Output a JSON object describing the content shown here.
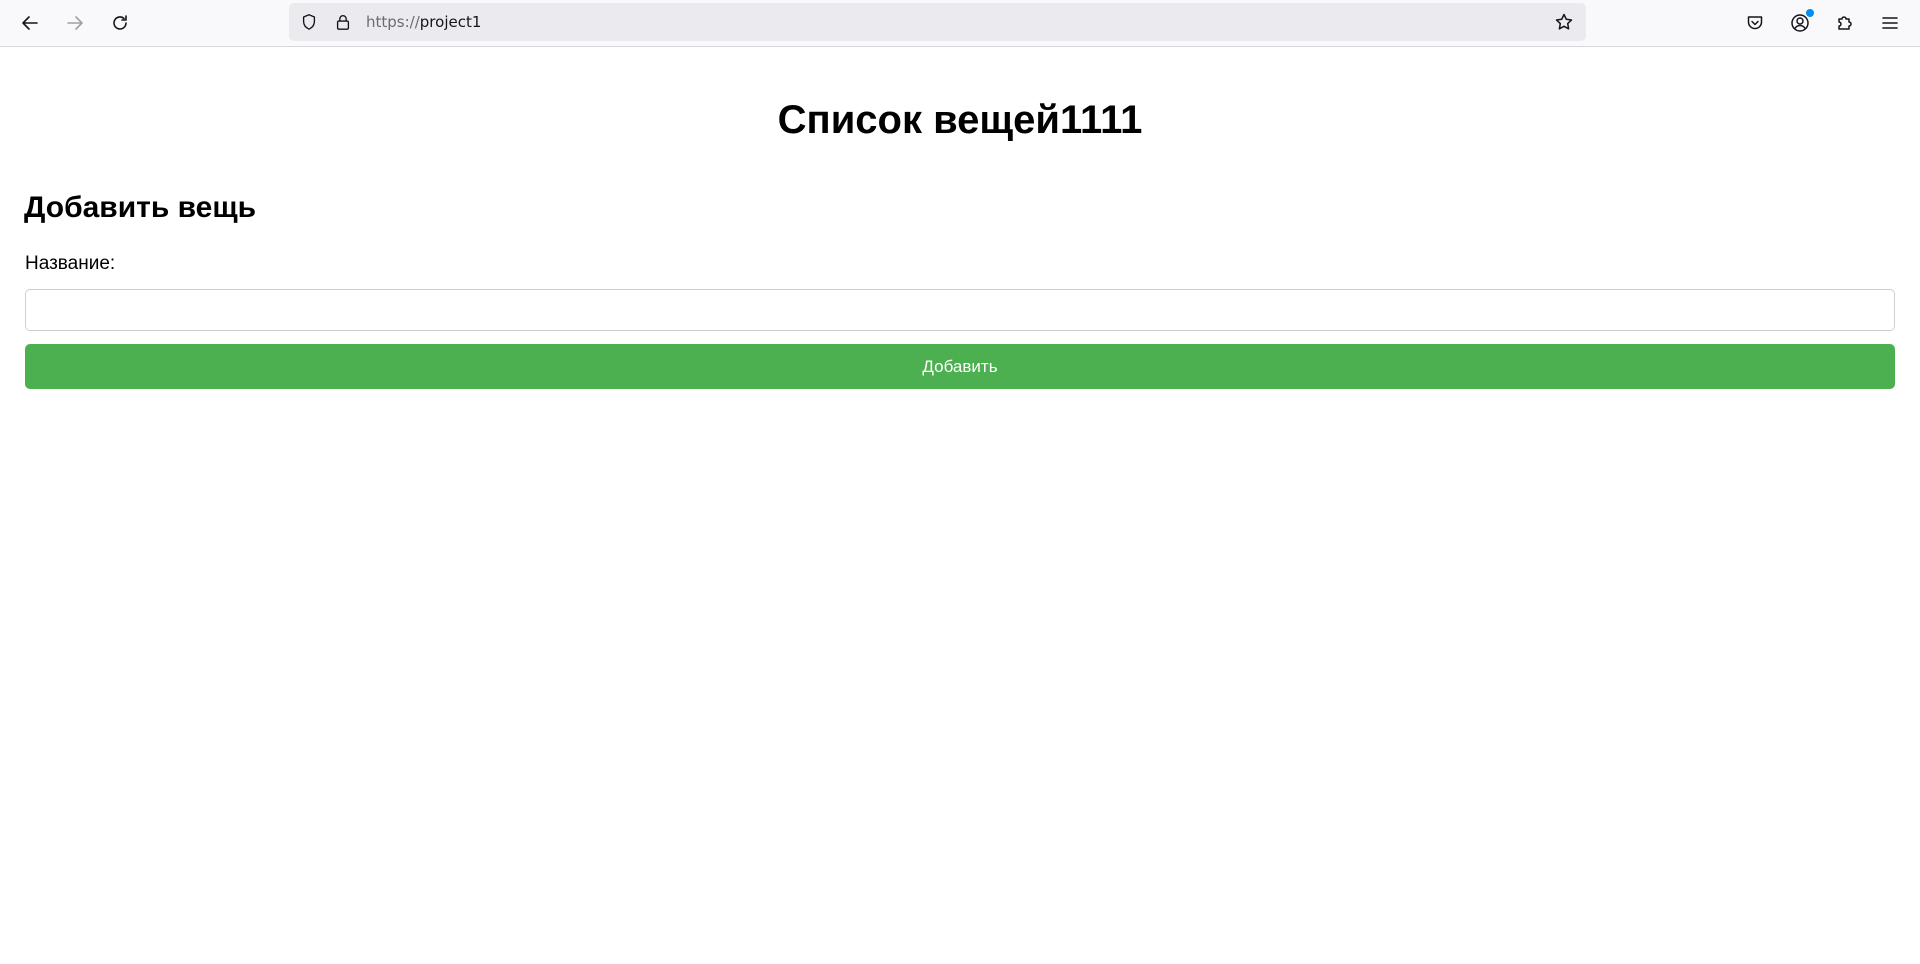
{
  "browser": {
    "url_scheme": "https://",
    "url_host": "project1",
    "icons": {
      "back": "arrow-left-icon",
      "forward": "arrow-right-icon",
      "reload": "reload-icon",
      "tracking_protection": "shield-icon",
      "site_security": "lock-icon",
      "bookmark": "star-icon",
      "pocket": "pocket-icon",
      "account": "account-icon",
      "extensions": "puzzle-icon",
      "menu": "hamburger-menu-icon"
    },
    "accent_color": "#0090ed"
  },
  "page": {
    "title": "Список вещей1111",
    "form": {
      "heading": "Добавить вещь",
      "name_label": "Название:",
      "name_value": "",
      "name_placeholder": "",
      "submit_label": "Добавить",
      "submit_color": "#4caf50"
    }
  }
}
